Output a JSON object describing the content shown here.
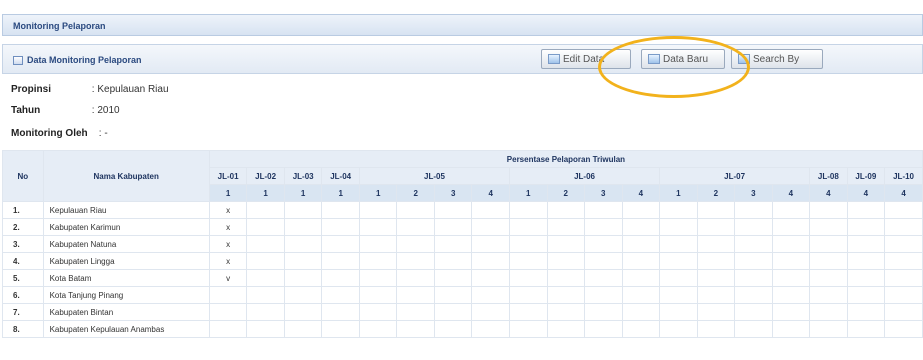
{
  "page_title": "Monitoring Pelaporan",
  "section": {
    "title": "Data Monitoring Pelaporan"
  },
  "toolbar": {
    "edit_label": "Edit Data",
    "baru_label": "Data Baru",
    "search_label": "Search By"
  },
  "info": {
    "propinsi_label": "Propinsi",
    "propinsi_value": ": Kepulauan Riau",
    "tahun_label": "Tahun",
    "tahun_value": ": 2010",
    "monitoring_label": "Monitoring Oleh",
    "monitoring_value": ": -"
  },
  "table": {
    "no_header": "No",
    "name_header": "Nama Kabupaten",
    "group_header": "Persentase Pelaporan Triwulan",
    "columns": [
      "JL-01",
      "JL-02",
      "JL-03",
      "JL-04",
      "JL-05",
      "JL-06",
      "JL-07",
      "JL-08",
      "JL-09",
      "JL-10"
    ],
    "sub_numbers": [
      "1",
      "1",
      "1",
      "1",
      "1",
      "2",
      "3",
      "4",
      "1",
      "2",
      "3",
      "4",
      "1",
      "2",
      "3",
      "4",
      "4",
      "4",
      "4"
    ],
    "rows": [
      {
        "no": "1.",
        "name": "Kepulauan Riau",
        "mark": "x"
      },
      {
        "no": "2.",
        "name": "Kabupaten Karimun",
        "mark": "x"
      },
      {
        "no": "3.",
        "name": "Kabupaten Natuna",
        "mark": "x"
      },
      {
        "no": "4.",
        "name": "Kabupaten Lingga",
        "mark": "x"
      },
      {
        "no": "5.",
        "name": "Kota Batam",
        "mark": "v"
      },
      {
        "no": "6.",
        "name": "Kota Tanjung Pinang",
        "mark": ""
      },
      {
        "no": "7.",
        "name": "Kabupaten Bintan",
        "mark": ""
      },
      {
        "no": "8.",
        "name": "Kabupaten Kepulauan Anambas",
        "mark": ""
      }
    ]
  },
  "colors": {
    "highlight": "#f2b21c",
    "header_bg": "#e6edf6"
  }
}
